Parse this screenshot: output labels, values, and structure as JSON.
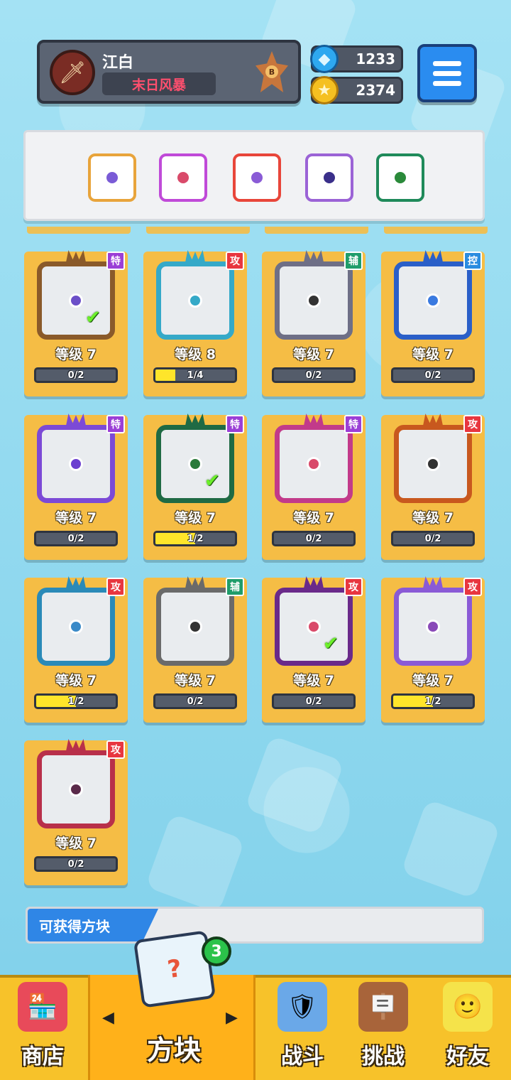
{
  "player": {
    "name": "江白",
    "title": "末日风暴",
    "rank": "B"
  },
  "currency": {
    "gems": "1233",
    "gold": "2374"
  },
  "deck": [
    {
      "color": "#e8a43b",
      "pip": "#7a5bd6"
    },
    {
      "color": "#c04ad8",
      "pip": "#d94a6a"
    },
    {
      "color": "#e8463a",
      "pip": "#8a5bd6"
    },
    {
      "color": "#9b63d6",
      "pip": "#3a2f8a"
    },
    {
      "color": "#1f8a5a",
      "pip": "#2a8a3a"
    }
  ],
  "cards": [
    {
      "tag": "特",
      "tag_type": "te",
      "level": "等级 7",
      "progress": "0/2",
      "fill": 0,
      "frame": "#8a5a2a",
      "pip": "#6b4fc8",
      "equipped": true
    },
    {
      "tag": "攻",
      "tag_type": "gong",
      "level": "等级 8",
      "progress": "1/4",
      "fill": 0.25,
      "frame": "#35a9c8",
      "pip": "#35a9c8",
      "equipped": false
    },
    {
      "tag": "辅",
      "tag_type": "fu",
      "level": "等级 7",
      "progress": "0/2",
      "fill": 0,
      "frame": "#6e6f86",
      "pip": "#333",
      "equipped": false
    },
    {
      "tag": "控",
      "tag_type": "kong",
      "level": "等级 7",
      "progress": "0/2",
      "fill": 0,
      "frame": "#2a5fc8",
      "pip": "#3a7ae0",
      "equipped": false
    },
    {
      "tag": "特",
      "tag_type": "te",
      "level": "等级 7",
      "progress": "0/2",
      "fill": 0,
      "frame": "#7c4ad6",
      "pip": "#6b3fd0",
      "equipped": false
    },
    {
      "tag": "特",
      "tag_type": "te",
      "level": "等级 7",
      "progress": "1/2",
      "fill": 0.5,
      "frame": "#1f6a44",
      "pip": "#2a7a3a",
      "equipped": true
    },
    {
      "tag": "特",
      "tag_type": "te",
      "level": "等级 7",
      "progress": "0/2",
      "fill": 0,
      "frame": "#c23a8a",
      "pip": "#d94a6a",
      "equipped": false
    },
    {
      "tag": "攻",
      "tag_type": "gong",
      "level": "等级 7",
      "progress": "0/2",
      "fill": 0,
      "frame": "#c8581e",
      "pip": "#333",
      "equipped": false
    },
    {
      "tag": "攻",
      "tag_type": "gong",
      "level": "等级 7",
      "progress": "1/2",
      "fill": 0.5,
      "frame": "#2a8ab8",
      "pip": "#3a8ac8",
      "equipped": false
    },
    {
      "tag": "辅",
      "tag_type": "fu",
      "level": "等级 7",
      "progress": "0/2",
      "fill": 0,
      "frame": "#6a6a6a",
      "pip": "#333",
      "equipped": false
    },
    {
      "tag": "攻",
      "tag_type": "gong",
      "level": "等级 7",
      "progress": "0/2",
      "fill": 0,
      "frame": "#6a2a8a",
      "pip": "#d94a6a",
      "equipped": true
    },
    {
      "tag": "攻",
      "tag_type": "gong",
      "level": "等级 7",
      "progress": "1/2",
      "fill": 0.5,
      "frame": "#8a5ad6",
      "pip": "#8a4ab8",
      "equipped": false
    },
    {
      "tag": "攻",
      "tag_type": "gong",
      "level": "等级 7",
      "progress": "0/2",
      "fill": 0,
      "frame": "#b8304a",
      "pip": "#5a2a4a",
      "equipped": false
    }
  ],
  "obtainable": {
    "label": "可获得方块"
  },
  "nav": {
    "shop": "商店",
    "blocks": "方块",
    "battle": "战斗",
    "challenge": "挑战",
    "friends": "好友",
    "blocks_badge": "3"
  }
}
